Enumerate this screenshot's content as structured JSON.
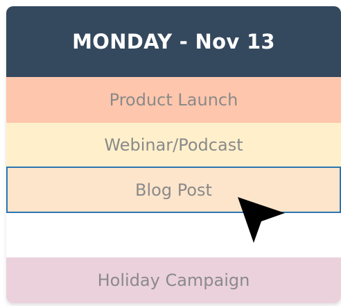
{
  "header": {
    "title": "MONDAY - Nov 13",
    "color": "#34495e"
  },
  "slots": [
    {
      "label": "Product Launch",
      "color": "#fec6ac"
    },
    {
      "label": "Webinar/Podcast",
      "color": "#fff0cb"
    },
    {
      "label": "Blog Post",
      "color": "#fde5cb",
      "selected": true,
      "border_color": "#2a75b3"
    },
    {
      "label": "",
      "color": "#ffffff"
    },
    {
      "label": "Holiday Campaign",
      "color": "#ebd1dc"
    }
  ],
  "cursor": {
    "icon": "arrow-cursor-icon",
    "color": "#000000"
  }
}
